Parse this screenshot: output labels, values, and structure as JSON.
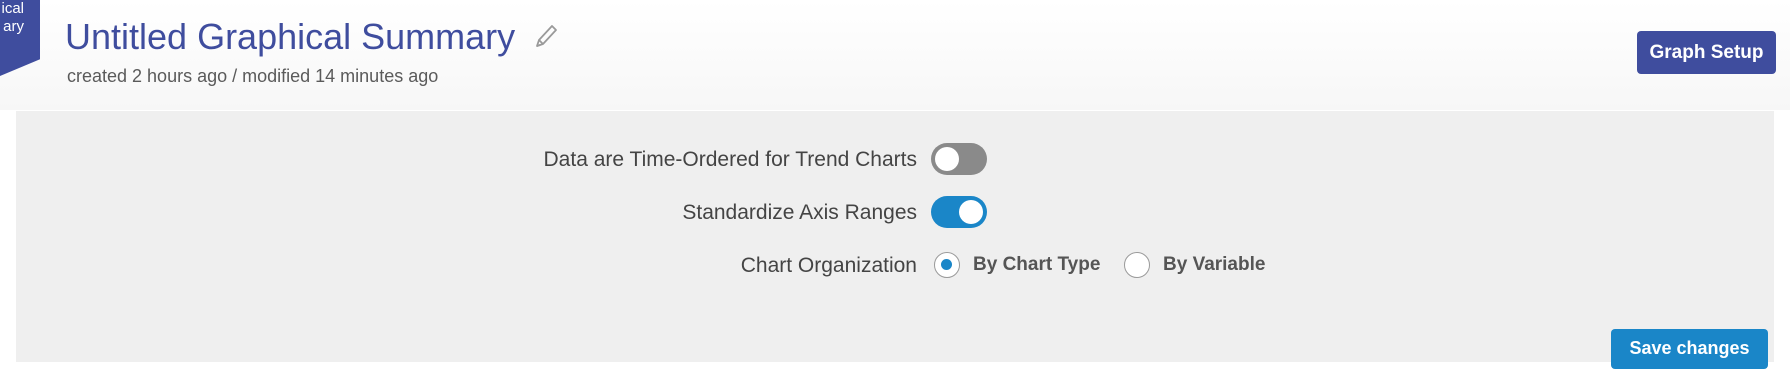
{
  "ribbon": {
    "line1": "ical",
    "line2": "ary"
  },
  "header": {
    "title": "Untitled Graphical Summary",
    "meta": "created 2 hours ago / modified 14 minutes ago",
    "graph_setup_label": "Graph Setup"
  },
  "settings": {
    "time_ordered": {
      "label": "Data are Time-Ordered for Trend Charts",
      "enabled": false
    },
    "standardize_axis": {
      "label": "Standardize Axis Ranges",
      "enabled": true
    },
    "chart_organization": {
      "label": "Chart Organization",
      "options": [
        "By Chart Type",
        "By Variable"
      ],
      "selected": "By Chart Type"
    }
  },
  "save_label": "Save changes",
  "colors": {
    "brand": "#3f4d9e",
    "accent": "#1a86c8",
    "toggle_off": "#8a8a8a",
    "panel": "#efefef"
  }
}
